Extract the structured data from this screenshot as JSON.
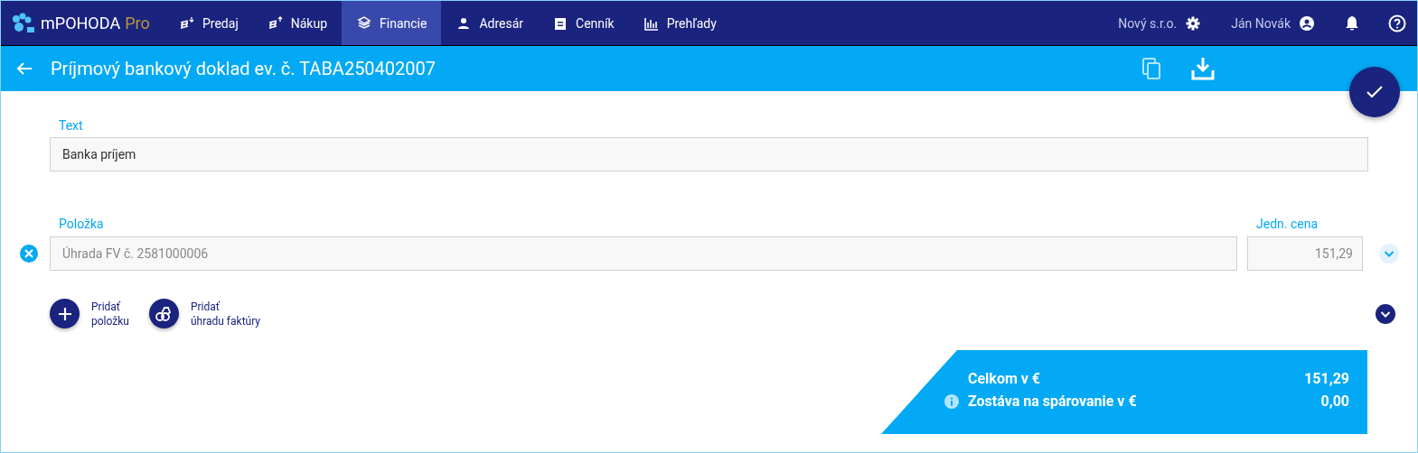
{
  "app": {
    "name": "mPOHODA",
    "edition": "Pro"
  },
  "nav": [
    {
      "label": "Predaj",
      "selected": false
    },
    {
      "label": "Nákup",
      "selected": false
    },
    {
      "label": "Financie",
      "selected": true
    },
    {
      "label": "Adresár",
      "selected": false
    },
    {
      "label": "Cenník",
      "selected": false
    },
    {
      "label": "Prehľady",
      "selected": false
    }
  ],
  "company": "Nový s.r.o.",
  "user": "Ján Novák",
  "page_title": "Príjmový bankový doklad ev. č. TABA250402007",
  "text_field": {
    "label": "Text",
    "value": "Banka príjem"
  },
  "item": {
    "label": "Položka",
    "value": "Úhrada FV č. 2581000006",
    "price_label": "Jedn. cena",
    "price": "151,29"
  },
  "add_buttons": [
    {
      "kind": "plus",
      "lines": [
        "Pridať",
        "položku"
      ]
    },
    {
      "kind": "invoice",
      "lines": [
        "Pridať",
        "úhradu faktúry"
      ]
    }
  ],
  "totals": [
    {
      "label": "Celkom v €",
      "value": "151,29",
      "info": false
    },
    {
      "label": "Zostáva na spárovanie v €",
      "value": "0,00",
      "info": true
    }
  ]
}
